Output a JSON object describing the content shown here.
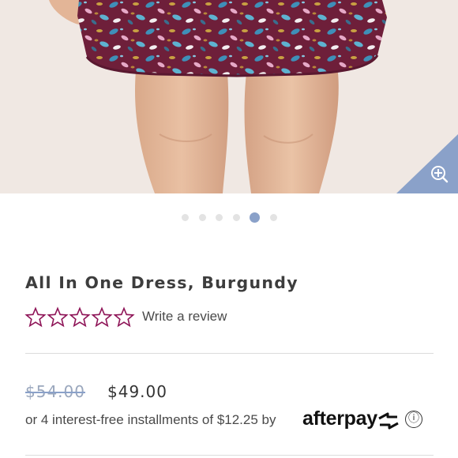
{
  "product": {
    "title": "All In One Dress, Burgundy",
    "rating": 0,
    "max_rating": 5,
    "review_link": "Write a review",
    "original_price": "$54.00",
    "sale_price": "$49.00",
    "installments_text": "or 4 interest-free installments of $12.25 by",
    "afterpay_label": "afterpay",
    "info_icon": "ⓘ"
  },
  "gallery": {
    "slide_count": 6,
    "active_index": 4,
    "zoom_icon": "zoom-in-icon"
  },
  "colors": {
    "accent": "#8aa1c9",
    "star_outline": "#8e1457",
    "dress_base": "#6e1f3a"
  }
}
